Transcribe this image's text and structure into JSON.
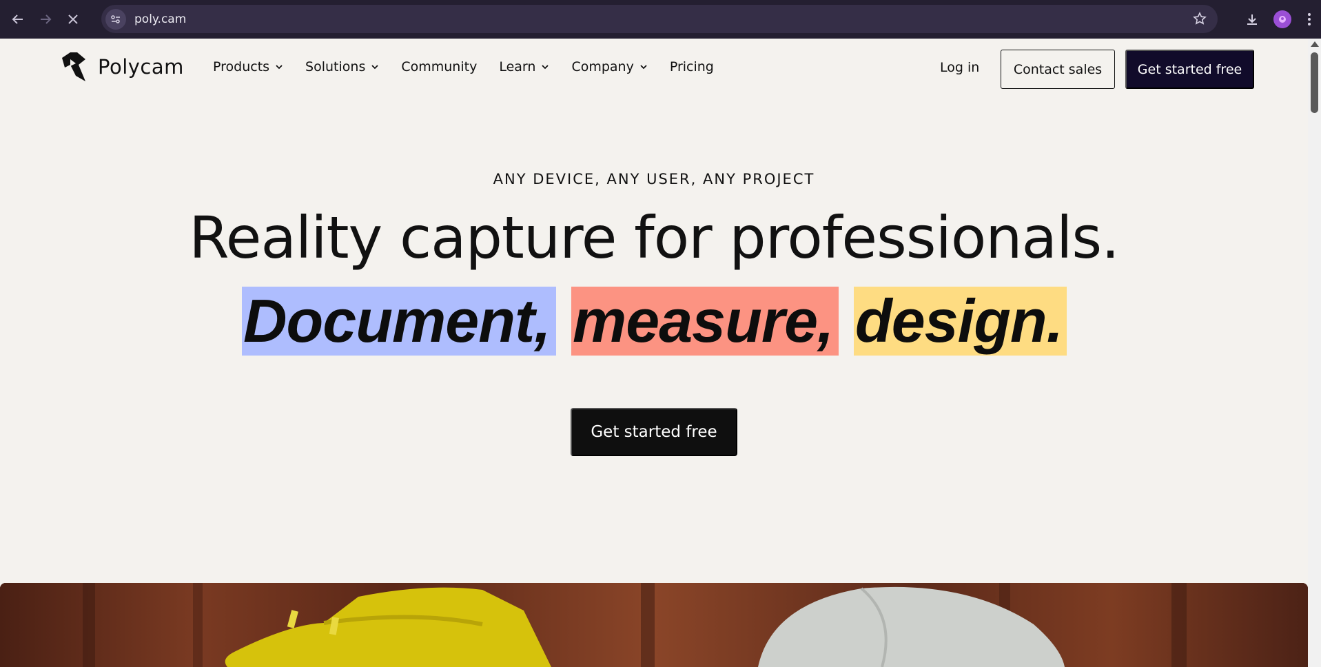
{
  "browser": {
    "url": "poly.cam",
    "icons": [
      "back-icon",
      "forward-icon",
      "stop-loading-icon",
      "site-info-icon",
      "bookmark-star-icon",
      "download-icon",
      "profile-avatar",
      "menu-kebab-icon"
    ]
  },
  "header": {
    "logo_text": "Polycam",
    "nav": [
      {
        "label": "Products",
        "has_dropdown": true
      },
      {
        "label": "Solutions",
        "has_dropdown": true
      },
      {
        "label": "Community",
        "has_dropdown": false
      },
      {
        "label": "Learn",
        "has_dropdown": true
      },
      {
        "label": "Company",
        "has_dropdown": true
      },
      {
        "label": "Pricing",
        "has_dropdown": false
      }
    ],
    "login_label": "Log in",
    "contact_label": "Contact sales",
    "start_label": "Get started free"
  },
  "hero": {
    "eyebrow": "ANY DEVICE, ANY USER, ANY PROJECT",
    "headline": "Reality capture for professionals.",
    "highlights": [
      {
        "text": "Document,",
        "color": "#aebdfe"
      },
      {
        "text": "measure,",
        "color": "#fc9382"
      },
      {
        "text": "design.",
        "color": "#fedc82"
      }
    ],
    "cta_label": "Get started free"
  },
  "colors": {
    "page_bg": "#f4f2ee",
    "brand_dark": "#110b2a",
    "chrome_bg": "#241f31"
  }
}
